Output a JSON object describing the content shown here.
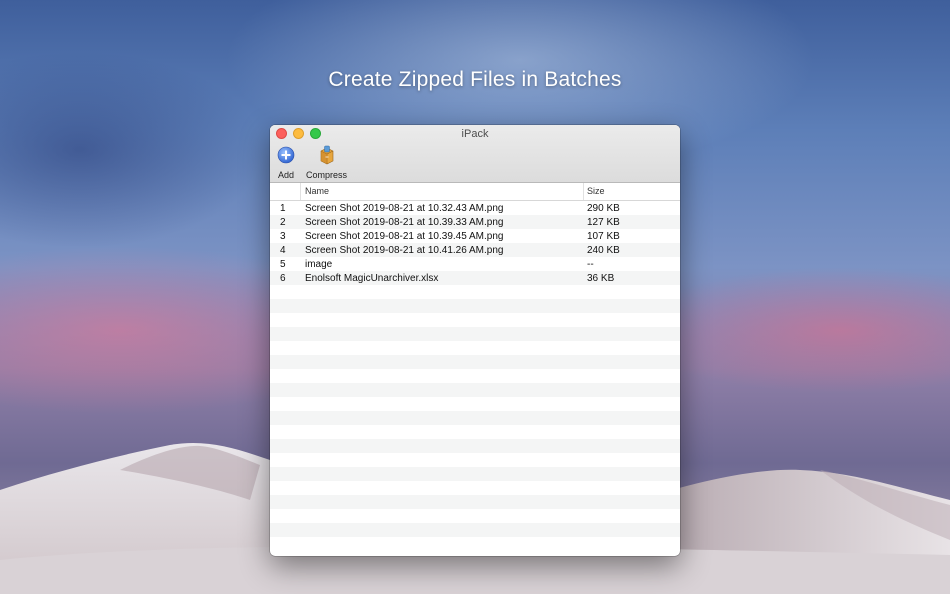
{
  "headline": "Create Zipped Files in Batches",
  "window": {
    "title": "iPack",
    "toolbar": {
      "add_label": "Add",
      "compress_label": "Compress"
    }
  },
  "table": {
    "columns": {
      "name": "Name",
      "size": "Size"
    },
    "rows": [
      {
        "index": "1",
        "name": "Screen Shot 2019-08-21 at 10.32.43 AM.png",
        "size": "290 KB"
      },
      {
        "index": "2",
        "name": "Screen Shot 2019-08-21 at 10.39.33 AM.png",
        "size": "127 KB"
      },
      {
        "index": "3",
        "name": "Screen Shot 2019-08-21 at 10.39.45 AM.png",
        "size": "107 KB"
      },
      {
        "index": "4",
        "name": "Screen Shot 2019-08-21 at 10.41.26 AM.png",
        "size": "240 KB"
      },
      {
        "index": "5",
        "name": "image",
        "size": "--"
      },
      {
        "index": "6",
        "name": "Enolsoft MagicUnarchiver.xlsx",
        "size": "36 KB"
      }
    ]
  },
  "icons": {
    "add": "plus-circle-icon",
    "compress": "box-archive-icon"
  },
  "colors": {
    "close": "#fc605c",
    "minimize": "#fdbc40",
    "zoom": "#34c84a",
    "add_icon": "#3d7be3"
  }
}
